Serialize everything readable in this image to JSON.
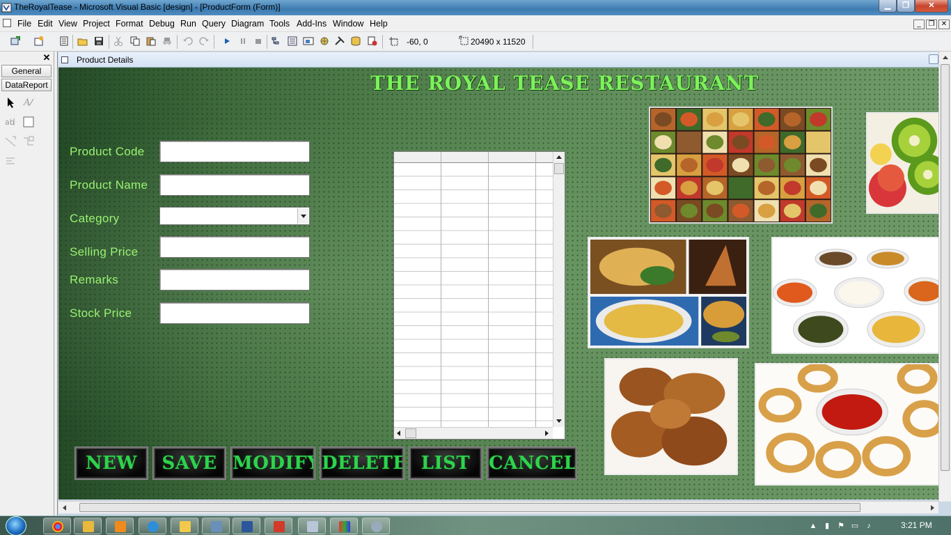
{
  "window": {
    "title": "TheRoyalTease - Microsoft Visual Basic [design] - [ProductForm (Form)]"
  },
  "menu": [
    "File",
    "Edit",
    "View",
    "Project",
    "Format",
    "Debug",
    "Run",
    "Query",
    "Diagram",
    "Tools",
    "Add-Ins",
    "Window",
    "Help"
  ],
  "toolbar": {
    "position_readout": "-60, 0",
    "size_readout": "20490 x 11520"
  },
  "toolbox": {
    "tabs": [
      "General",
      "DataReport"
    ]
  },
  "form": {
    "caption": "Product Details",
    "heading": "THE ROYAL TEASE RESTAURANT",
    "fields": {
      "product_code": {
        "label": "Product Code",
        "value": ""
      },
      "product_name": {
        "label": "Product Name",
        "value": ""
      },
      "category": {
        "label": "Category",
        "value": ""
      },
      "selling_price": {
        "label": "Selling Price",
        "value": ""
      },
      "remarks": {
        "label": "Remarks",
        "value": ""
      },
      "stock_price": {
        "label": "Stock Price",
        "value": ""
      }
    },
    "buttons": {
      "new": "NEW",
      "save": "SAVE",
      "modify": "MODIFY",
      "delete": "DELETE",
      "list": "LIST",
      "cancel": "CANCEL"
    },
    "accent_color": "#7cf25a",
    "button_text_color": "#2fd24d"
  },
  "taskbar": {
    "clock": "3:21 PM"
  }
}
